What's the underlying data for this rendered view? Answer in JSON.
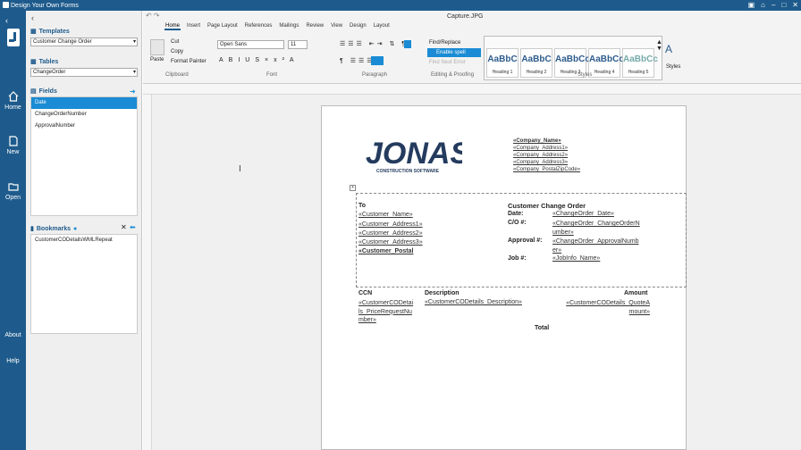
{
  "window": {
    "title": "Design Your Own Forms",
    "doc_name": "Capture.JPG"
  },
  "nav": {
    "home": "Home",
    "new": "New",
    "open": "Open",
    "about": "About",
    "help": "Help"
  },
  "panel": {
    "templates_label": "Templates",
    "template_value": "Customer Change Order",
    "tables_label": "Tables",
    "table_value": "ChangeOrder",
    "fields_label": "Fields",
    "fields": [
      "Date",
      "ChangeOrderNumber",
      "ApprovalNumber"
    ],
    "bookmarks_label": "Bookmarks",
    "bookmarks": [
      "CustomerCODetailsWMLRepeat"
    ]
  },
  "ribbon": {
    "tabs": [
      "Home",
      "Insert",
      "Page Layout",
      "References",
      "Mailings",
      "Review",
      "View",
      "Design",
      "Layout"
    ],
    "paste": "Paste",
    "cut": "Cut",
    "copy": "Copy",
    "format_painter": "Format Painter",
    "clipboard": "Clipboard",
    "font_name": "Open Sans",
    "font_size": "11",
    "font": "Font",
    "paragraph": "Paragraph",
    "find_replace": "Find/Replace",
    "spell_check": "Enable spell check",
    "find_next": "Find Next Error",
    "editing": "Editing & Proofing",
    "styles_group": "Styles",
    "styles_btn": "Styles",
    "style_sample": "AaBbC",
    "style_sample_long": "AaBbCc",
    "styles": [
      "Heading 1",
      "Heading 2",
      "Heading 3",
      "Heading 4",
      "Heading 5"
    ]
  },
  "document": {
    "company_fields": [
      "«Company_Name»",
      "«Company_Address1»",
      "«Company_Address2»",
      "«Company_Address3»",
      "«Company_PostalZipCode»"
    ],
    "logo": "JONAS",
    "logo_sub": "CONSTRUCTION SOFTWARE",
    "to": "To",
    "customer_fields": [
      "«Customer_Name»",
      "«Customer_Address1»",
      "«Customer_Address2»",
      "«Customer_Address3»",
      "«Customer_Postal"
    ],
    "heading": "Customer Change Order",
    "date_label": "Date:",
    "date_value": "«ChangeOrder_Date»",
    "co_label": "C/O #:",
    "co_value_1": "«ChangeOrder_ChangeOrderN",
    "co_value_2": "umber»",
    "approval_label": "Approval #:",
    "approval_value_1": "«ChangeOrder_ApprovalNumb",
    "approval_value_2": "er»",
    "job_label": "Job #:",
    "job_value": "«JobInfo_Name»",
    "col_ccn": "CCN",
    "col_desc": "Description",
    "col_amount": "Amount",
    "ccn_1": "«CustomerCODetai",
    "ccn_2": "ls_PriceRequestNu",
    "ccn_3": "mber»",
    "desc_value": "«CustomerCODetails_Description»",
    "amount_1": "«CustomerCODetails_QuoteA",
    "amount_2": "mount»",
    "total": "Total"
  }
}
